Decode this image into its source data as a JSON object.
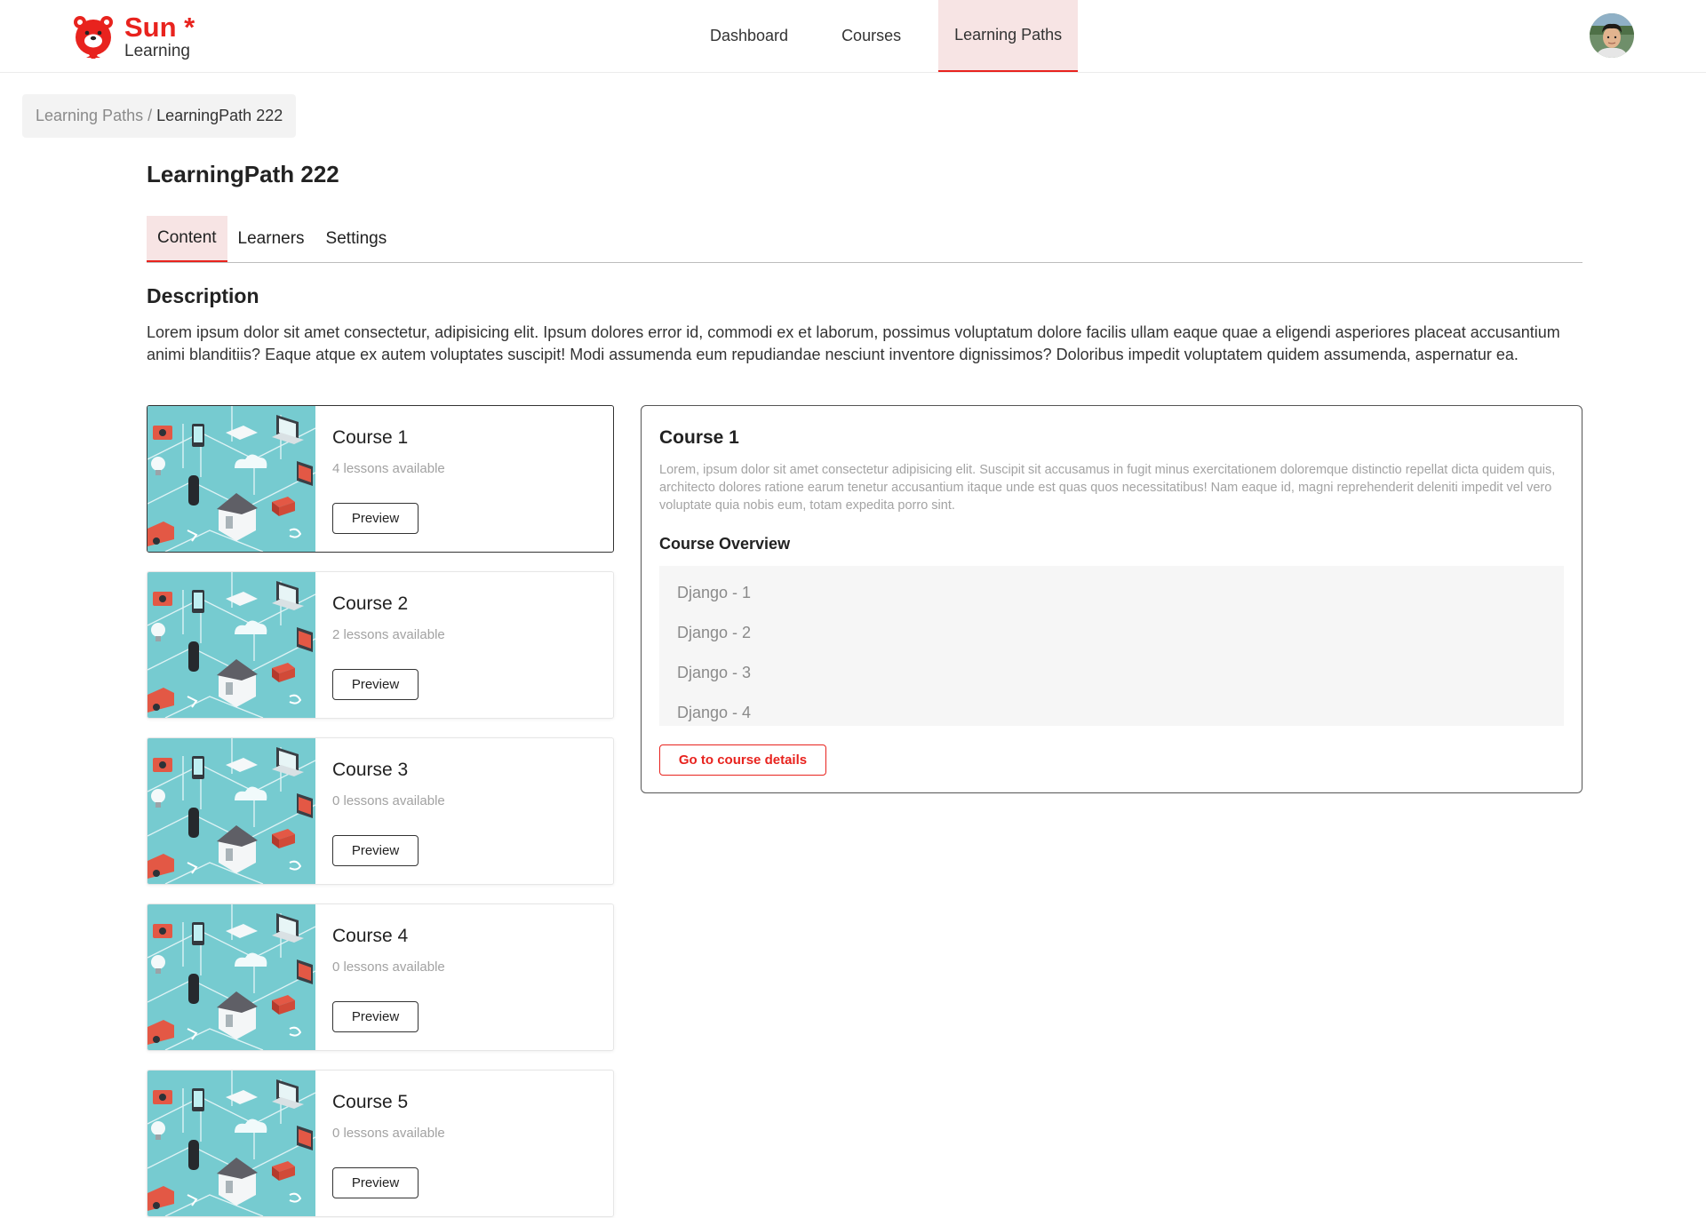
{
  "brand": {
    "name": "Sun *",
    "sub": "Learning",
    "color": "#e8231e",
    "icon": "bear-logo-icon"
  },
  "nav": [
    {
      "label": "Dashboard",
      "active": false
    },
    {
      "label": "Courses",
      "active": false
    },
    {
      "label": "Learning Paths",
      "active": true
    }
  ],
  "user": {
    "icon": "avatar-photo"
  },
  "breadcrumb": {
    "parent": "Learning Paths",
    "separator": "/",
    "current": "LearningPath 222"
  },
  "page": {
    "title": "LearningPath 222"
  },
  "tabs": [
    {
      "label": "Content",
      "active": true
    },
    {
      "label": "Learners",
      "active": false
    },
    {
      "label": "Settings",
      "active": false
    }
  ],
  "description": {
    "heading": "Description",
    "text": "Lorem ipsum dolor sit amet consectetur, adipisicing elit. Ipsum dolores error id, commodi ex et laborum, possimus voluptatum dolore facilis ullam eaque quae a eligendi asperiores placeat accusantium animi blanditiis? Eaque atque ex autem voluptates suscipit! Modi assumenda eum repudiandae nesciunt inventore dignissimos? Doloribus impedit voluptatem quidem assumenda, aspernatur ea."
  },
  "courses": [
    {
      "title": "Course 1",
      "lessons": "4 lessons available",
      "button": "Preview",
      "selected": true
    },
    {
      "title": "Course 2",
      "lessons": "2 lessons available",
      "button": "Preview",
      "selected": false
    },
    {
      "title": "Course 3",
      "lessons": "0 lessons available",
      "button": "Preview",
      "selected": false
    },
    {
      "title": "Course 4",
      "lessons": "0 lessons available",
      "button": "Preview",
      "selected": false
    },
    {
      "title": "Course 5",
      "lessons": "0 lessons available",
      "button": "Preview",
      "selected": false
    }
  ],
  "detail": {
    "title": "Course 1",
    "text": "Lorem, ipsum dolor sit amet consectetur adipisicing elit. Suscipit sit accusamus in fugit minus exercitationem doloremque distinctio repellat dicta quidem quis, architecto dolores ratione earum tenetur accusantium itaque unde est quas quos necessitatibus! Nam eaque id, magni reprehenderit deleniti impedit vel vero voluptate quia nobis eum, totam expedita porro sint.",
    "overview_heading": "Course Overview",
    "lessons": [
      "Django - 1",
      "Django - 2",
      "Django - 3",
      "Django - 4"
    ],
    "button": "Go to course details"
  }
}
